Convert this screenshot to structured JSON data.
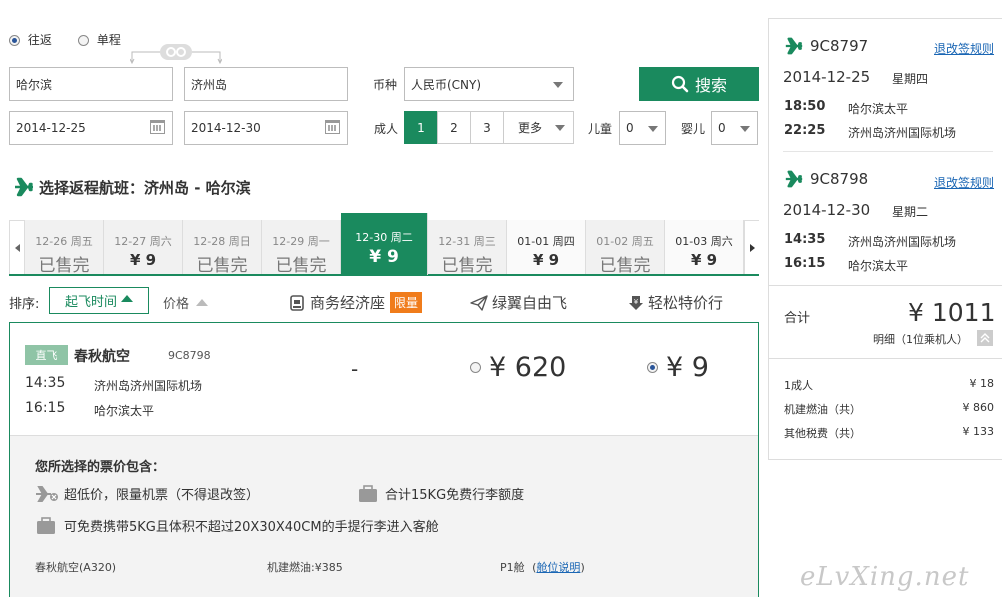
{
  "search": {
    "trip_round": "往返",
    "trip_single": "单程",
    "from_city": "哈尔滨",
    "to_city": "济州岛",
    "depart_date": "2014-12-25",
    "return_date": "2014-12-30",
    "currency_label": "币种",
    "currency_value": "人民币(CNY)",
    "search_button": "搜索",
    "adult_label": "成人",
    "adult_options": [
      "1",
      "2",
      "3"
    ],
    "adult_more": "更多",
    "child_label": "儿童",
    "child_value": "0",
    "infant_label": "婴儿",
    "infant_value": "0"
  },
  "section_title": "选择返程航班：济州岛 - 哈尔滨",
  "date_tabs": [
    {
      "date": "12-26",
      "weekday": "周五",
      "price": "已售完"
    },
    {
      "date": "12-27",
      "weekday": "周六",
      "price": "¥ 9"
    },
    {
      "date": "12-28",
      "weekday": "周日",
      "price": "已售完"
    },
    {
      "date": "12-29",
      "weekday": "周一",
      "price": "已售完"
    },
    {
      "date": "12-30",
      "weekday": "周二",
      "price": "¥ 9"
    },
    {
      "date": "12-31",
      "weekday": "周三",
      "price": "已售完"
    },
    {
      "date": "01-01",
      "weekday": "周四",
      "price": "¥ 9"
    },
    {
      "date": "01-02",
      "weekday": "周五",
      "price": "已售完"
    },
    {
      "date": "01-03",
      "weekday": "周六",
      "price": "¥ 9"
    }
  ],
  "sort": {
    "label": "排序:",
    "by_time": "起飞时间",
    "by_price": "价格",
    "cabin_business": "商务经济座",
    "cabin_business_badge": "限量",
    "cabin_green": "绿翼自由飞",
    "cabin_easy": "轻松特价行"
  },
  "flight": {
    "direct_badge": "直飞",
    "airline": "春秋航空",
    "flight_no": "9C8798",
    "dep_time": "14:35",
    "dep_airport": "济州岛济州国际机场",
    "arr_time": "16:15",
    "arr_airport": "哈尔滨太平",
    "business_price": "-",
    "green_price": "¥ 620",
    "easy_price": "¥ 9"
  },
  "details": {
    "title": "您所选择的票价包含：",
    "item1": "超低价，限量机票（不得退改签）",
    "item2": "合计15KG免费行李额度",
    "item3": "可免费携带5KG且体积不超过20X30X40CM的手提行李进入客舱",
    "footer_airline": "春秋航空(A320)",
    "footer_fuel": "机建燃油:¥385",
    "footer_cabin": "P1舱",
    "footer_cabin_link": "舱位说明"
  },
  "summary": {
    "legs": [
      {
        "flight_no": "9C8797",
        "rule_link": "退改签规则",
        "date": "2014-12-25",
        "weekday": "星期四",
        "dep_time": "18:50",
        "dep_airport": "哈尔滨太平",
        "arr_time": "22:25",
        "arr_airport": "济州岛济州国际机场"
      },
      {
        "flight_no": "9C8798",
        "rule_link": "退改签规则",
        "date": "2014-12-30",
        "weekday": "星期二",
        "dep_time": "14:35",
        "dep_airport": "济州岛济州国际机场",
        "arr_time": "16:15",
        "arr_airport": "哈尔滨太平"
      }
    ],
    "total_label": "合计",
    "total_value": "¥ 1011",
    "detail_label": "明细（1位乘机人）",
    "rows": [
      {
        "label": "1成人",
        "value": "¥ 18"
      },
      {
        "label": "机建燃油（共）",
        "value": "¥ 860"
      },
      {
        "label": "其他税费（共）",
        "value": "¥ 133"
      }
    ]
  },
  "watermark": "eLvXing.net",
  "colors": {
    "brand_green": "#1a8a5e",
    "badge_orange": "#f07c1b",
    "link_blue": "#1a66b4"
  }
}
